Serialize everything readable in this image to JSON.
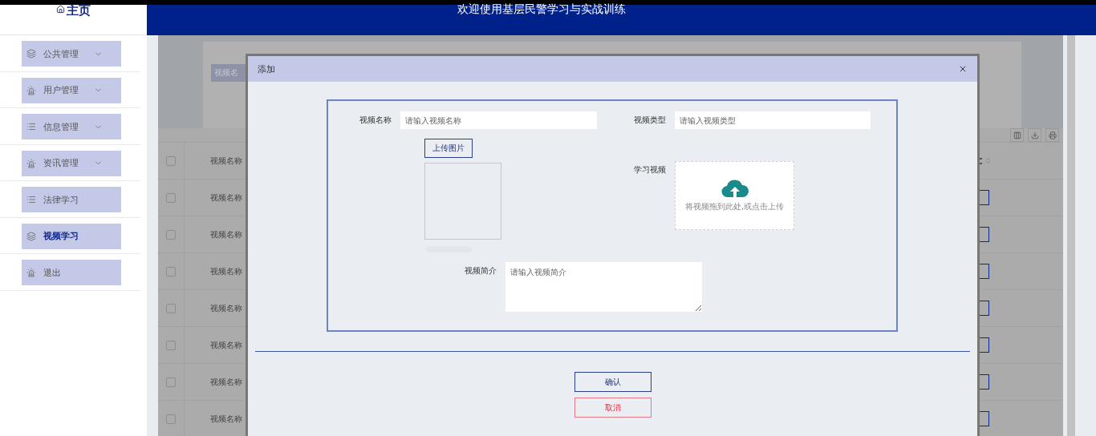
{
  "logo": {
    "title": "主页"
  },
  "header": {
    "title": "欢迎使用基层民警学习与实战训练"
  },
  "sidebar": {
    "items": [
      {
        "label": "公共管理",
        "kind": "layers",
        "has_submenu": true,
        "selected": false
      },
      {
        "label": "用户管理",
        "kind": "alarm",
        "has_submenu": true,
        "selected": false
      },
      {
        "label": "信息管理",
        "kind": "list",
        "has_submenu": true,
        "selected": false
      },
      {
        "label": "资讯管理",
        "kind": "alarm",
        "has_submenu": true,
        "selected": false
      },
      {
        "label": "法律学习",
        "kind": "list",
        "has_submenu": false,
        "selected": false
      },
      {
        "label": "视频学习",
        "kind": "layers",
        "has_submenu": false,
        "selected": true
      },
      {
        "label": "退出",
        "kind": "alarm",
        "has_submenu": false,
        "selected": false
      }
    ]
  },
  "background": {
    "search_label": "视频名",
    "table": {
      "columns": [
        "视频名称"
      ],
      "all_checked": false,
      "rows": [
        {
          "name": "视频名称",
          "checked": false
        },
        {
          "name": "视频名称",
          "checked": false
        },
        {
          "name": "视频名称",
          "checked": false
        },
        {
          "name": "视频名称",
          "checked": false
        },
        {
          "name": "视频名称",
          "checked": false
        },
        {
          "name": "视频名称",
          "checked": false
        },
        {
          "name": "视频名称",
          "checked": false
        }
      ]
    }
  },
  "modal": {
    "title": "添加",
    "form": {
      "name": {
        "label": "视频名称",
        "placeholder": "请输入视频名称"
      },
      "type": {
        "label": "视频类型",
        "placeholder": "请输入视频类型"
      },
      "upload_button": "上传图片",
      "video": {
        "label": "学习视频",
        "hint": "将视频拖到此处,或点击上传"
      },
      "intro": {
        "label": "视频简介",
        "placeholder": "请输入视频简介"
      }
    },
    "buttons": {
      "confirm": "确认",
      "cancel": "取消"
    }
  }
}
